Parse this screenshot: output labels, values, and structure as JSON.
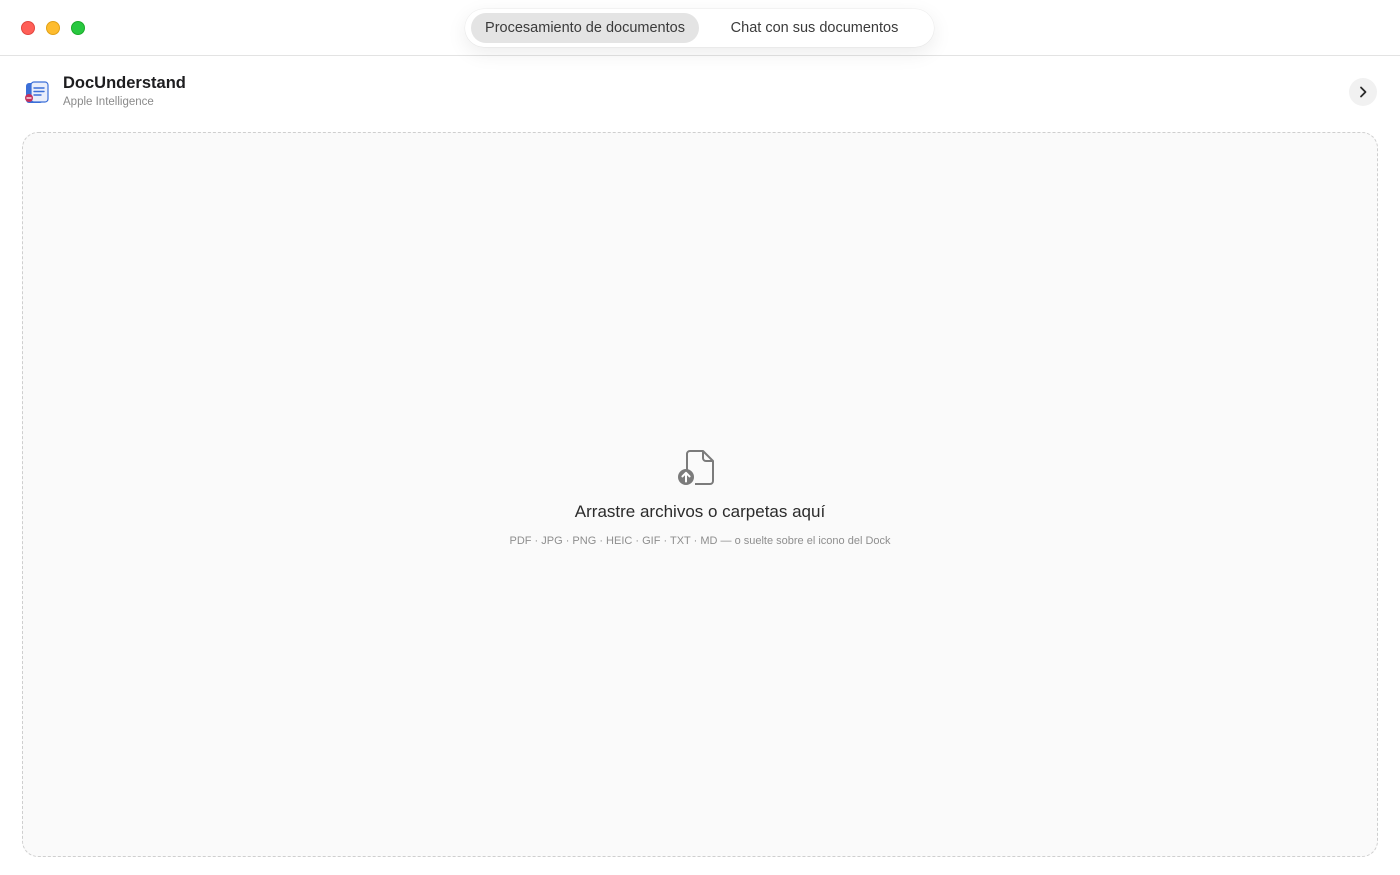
{
  "tabs": {
    "active": "Procesamiento de documentos",
    "inactive": "Chat con sus documentos"
  },
  "app": {
    "title": "DocUnderstand",
    "subtitle": "Apple Intelligence"
  },
  "dropzone": {
    "title": "Arrastre archivos o carpetas aquí",
    "hint": "PDF · JPG · PNG · HEIC · GIF · TXT · MD — o suelte sobre el icono del Dock"
  },
  "icons": {
    "logo": "app-logo-icon",
    "expand": "chevron-right-icon",
    "upload": "document-upload-icon"
  },
  "colors": {
    "close": "#ff5f57",
    "minimize": "#febc2e",
    "maximize": "#28c840",
    "active_tab_bg": "#e4e4e4",
    "dropzone_border": "#cfcfcf"
  }
}
